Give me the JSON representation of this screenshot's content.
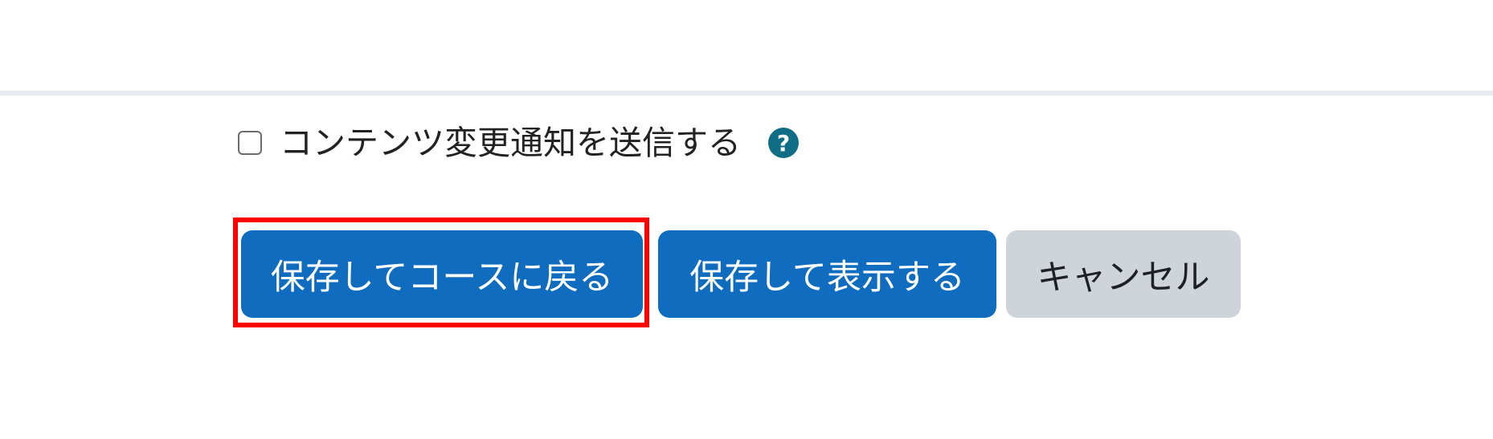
{
  "form": {
    "notify_checkbox": {
      "label": "コンテンツ変更通知を送信する",
      "checked": false
    },
    "help_icon_glyph": "?",
    "buttons": {
      "save_return": "保存してコースに戻る",
      "save_display": "保存して表示する",
      "cancel": "キャンセル"
    }
  },
  "colors": {
    "primary": "#0f6cbf",
    "secondary": "#ced4da",
    "help_icon": "#0f6e85",
    "highlight": "#ff0000"
  },
  "icons": {
    "help": "question-circle-icon"
  }
}
